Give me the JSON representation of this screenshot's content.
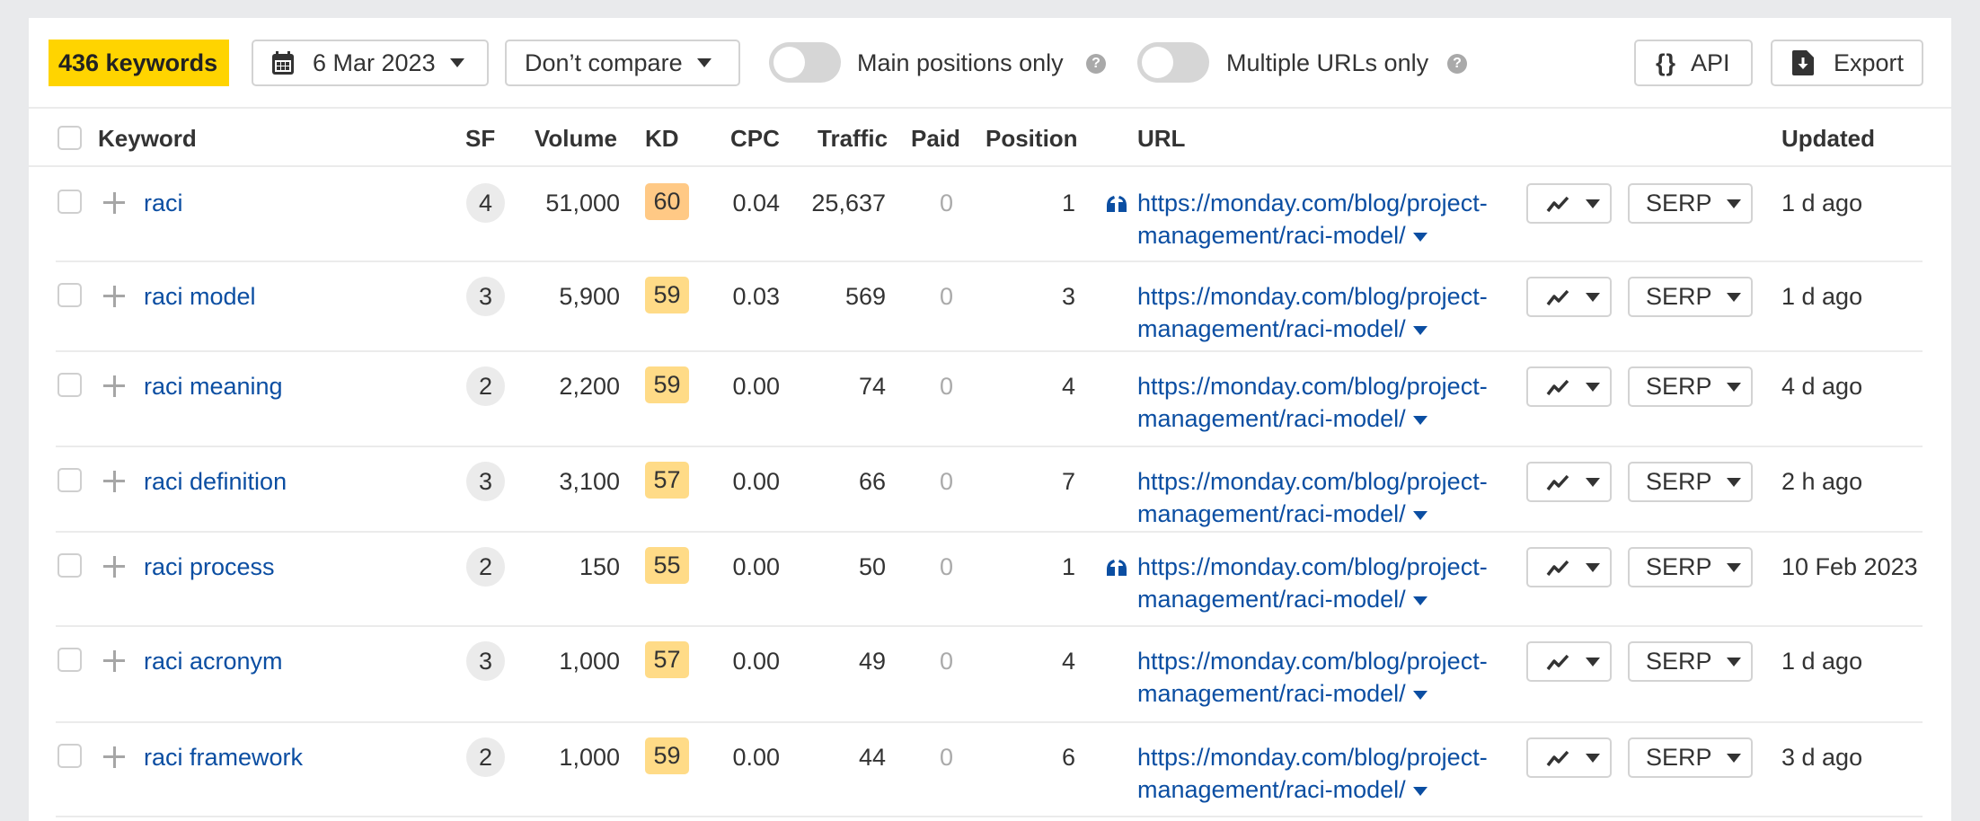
{
  "toolbar": {
    "keyword_count": "436 keywords",
    "date": "6 Mar 2023",
    "compare": "Don’t compare",
    "main_positions_label": "Main positions only",
    "main_positions_on": false,
    "multiple_urls_label": "Multiple URLs only",
    "multiple_urls_on": false,
    "help_glyph": "?",
    "api_icon": "{}",
    "api_label": "API",
    "export_label": "Export"
  },
  "colors": {
    "accent_yellow": "#ffd400",
    "link_blue": "#0b4ea2",
    "kd_medium": "#ffdb87",
    "kd_hard": "#ffc985"
  },
  "table": {
    "headers": {
      "keyword": "Keyword",
      "sf": "SF",
      "volume": "Volume",
      "kd": "KD",
      "cpc": "CPC",
      "traffic": "Traffic",
      "paid": "Paid",
      "position": "Position",
      "url": "URL",
      "updated": "Updated"
    },
    "serp_label": "SERP",
    "rows": [
      {
        "keyword": "raci",
        "sf": "4",
        "volume": "51,000",
        "kd": "60",
        "kd_level": "hard",
        "cpc": "0.04",
        "traffic": "25,637",
        "paid": "0",
        "position": "1",
        "featured_snippet": true,
        "url": "https://monday.com/blog/project-management/raci-model/",
        "updated": "1 d ago"
      },
      {
        "keyword": "raci model",
        "sf": "3",
        "volume": "5,900",
        "kd": "59",
        "kd_level": "medium",
        "cpc": "0.03",
        "traffic": "569",
        "paid": "0",
        "position": "3",
        "featured_snippet": false,
        "url": "https://monday.com/blog/project-management/raci-model/",
        "updated": "1 d ago"
      },
      {
        "keyword": "raci meaning",
        "sf": "2",
        "volume": "2,200",
        "kd": "59",
        "kd_level": "medium",
        "cpc": "0.00",
        "traffic": "74",
        "paid": "0",
        "position": "4",
        "featured_snippet": false,
        "url": "https://monday.com/blog/project-management/raci-model/",
        "updated": "4 d ago"
      },
      {
        "keyword": "raci definition",
        "sf": "3",
        "volume": "3,100",
        "kd": "57",
        "kd_level": "medium",
        "cpc": "0.00",
        "traffic": "66",
        "paid": "0",
        "position": "7",
        "featured_snippet": false,
        "url": "https://monday.com/blog/project-management/raci-model/",
        "updated": "2 h ago"
      },
      {
        "keyword": "raci process",
        "sf": "2",
        "volume": "150",
        "kd": "55",
        "kd_level": "medium",
        "cpc": "0.00",
        "traffic": "50",
        "paid": "0",
        "position": "1",
        "featured_snippet": true,
        "url": "https://monday.com/blog/project-management/raci-model/",
        "updated": "10 Feb 2023"
      },
      {
        "keyword": "raci acronym",
        "sf": "3",
        "volume": "1,000",
        "kd": "57",
        "kd_level": "medium",
        "cpc": "0.00",
        "traffic": "49",
        "paid": "0",
        "position": "4",
        "featured_snippet": false,
        "url": "https://monday.com/blog/project-management/raci-model/",
        "updated": "1 d ago"
      },
      {
        "keyword": "raci framework",
        "sf": "2",
        "volume": "1,000",
        "kd": "59",
        "kd_level": "medium",
        "cpc": "0.00",
        "traffic": "44",
        "paid": "0",
        "position": "6",
        "featured_snippet": false,
        "url": "https://monday.com/blog/project-management/raci-model/",
        "updated": "3 d ago"
      }
    ]
  }
}
